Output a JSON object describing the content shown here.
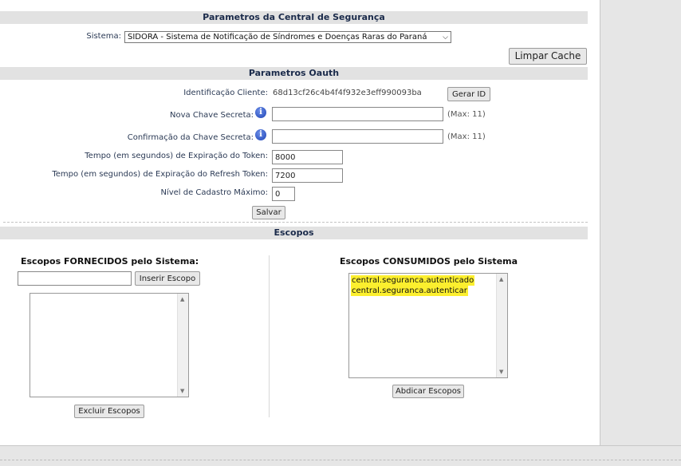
{
  "central": {
    "header": "Parametros da Central de Segurança",
    "sistema_label": "Sistema:",
    "sistema_value": "SIDORA - Sistema de Notificação de Síndromes e Doenças Raras do Paraná",
    "limpar_cache": "Limpar Cache"
  },
  "oauth": {
    "header": "Parametros Oauth",
    "client_id_label": "Identificação Cliente:",
    "client_id_value": "68d13cf26c4b4f4f932e3eff990093ba",
    "gerar_id": "Gerar ID",
    "nova_chave_label": "Nova Chave Secreta:",
    "nova_chave_max": "(Max: 11)",
    "confirm_label": "Confirmação da Chave Secreta:",
    "confirm_max": "(Max: 11)",
    "token_exp_label": "Tempo (em segundos) de Expiração do Token:",
    "token_exp_value": "8000",
    "refresh_exp_label": "Tempo (em segundos) de Expiração do Refresh Token:",
    "refresh_exp_value": "7200",
    "nivel_label": "Nível de Cadastro Máximo:",
    "nivel_value": "0",
    "salvar": "Salvar"
  },
  "escopos": {
    "header": "Escopos",
    "fornecidos_title": "Escopos FORNECIDOS pelo Sistema:",
    "inserir": "Inserir Escopo",
    "excluir": "Excluir Escopos",
    "consumidos_title": "Escopos CONSUMIDOS pelo Sistema",
    "consumidos_items": [
      "central.seguranca.autenticado",
      "central.seguranca.autenticar"
    ],
    "abdicar": "Abdicar Escopos"
  },
  "colors": {
    "header_bg": "#e2e2e2",
    "highlight": "#fcef2e",
    "info_icon": "#1f44b5"
  }
}
